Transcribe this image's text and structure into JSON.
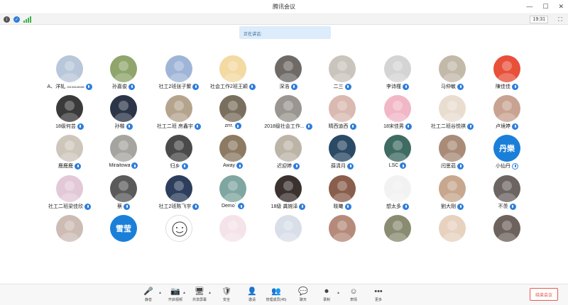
{
  "window": {
    "title": "腾讯会议",
    "controls": [
      "—",
      "☐",
      "✕"
    ]
  },
  "infobar": {
    "time": "19:31"
  },
  "speaking": {
    "label": "正在讲话:"
  },
  "participants": [
    {
      "name": "A、洋轧",
      "suffix": "15134448188",
      "avatar_color": "#b8c7d9",
      "avatar_text": "",
      "mic": "on"
    },
    {
      "name": "孙嘉俊",
      "avatar_color": "#8fa56b",
      "avatar_text": "",
      "mic": "on"
    },
    {
      "name": "社工2班张子蘩",
      "avatar_color": "#9fb5d8",
      "avatar_text": "",
      "mic": "on"
    },
    {
      "name": "社会工作2班王颖",
      "avatar_color": "#f3d9a2",
      "avatar_text": "",
      "mic": "on"
    },
    {
      "name": "深浩",
      "avatar_color": "#6f6a66",
      "avatar_text": "",
      "mic": "on"
    },
    {
      "name": "二三",
      "avatar_color": "#c9c4bc",
      "avatar_text": "",
      "mic": "on"
    },
    {
      "name": "李诗槿",
      "avatar_color": "#d4d4d4",
      "avatar_text": "",
      "mic": "on"
    },
    {
      "name": "马仲敏",
      "avatar_color": "#c2b9a8",
      "avatar_text": "",
      "mic": "on"
    },
    {
      "name": "陳佳佳",
      "avatar_color": "#e8503a",
      "avatar_text": "",
      "mic": "on"
    },
    {
      "name": "18级何芸",
      "avatar_color": "#3a3a3a",
      "avatar_text": "",
      "mic": "on"
    },
    {
      "name": "孙楷",
      "avatar_color": "#2c3548",
      "avatar_text": "",
      "mic": "on"
    },
    {
      "name": "社工二班 房鑫宇",
      "avatar_color": "#b5a48d",
      "avatar_text": "",
      "mic": "on"
    },
    {
      "name": "zrrr.",
      "avatar_color": "#7a6f5e",
      "avatar_text": "",
      "mic": "on"
    },
    {
      "name": "2018级社会工作...",
      "avatar_color": "#9a9590",
      "avatar_text": "",
      "mic": "on"
    },
    {
      "name": "晴西迪西",
      "avatar_color": "#d9b9b0",
      "avatar_text": "",
      "mic": "on"
    },
    {
      "name": "18宋佳男",
      "avatar_color": "#f1b7c7",
      "avatar_text": "",
      "mic": "on"
    },
    {
      "name": "社工二班谷悦祺",
      "avatar_color": "#e9ddd0",
      "avatar_text": "",
      "mic": "on"
    },
    {
      "name": "卢境婷",
      "avatar_color": "#c8a391",
      "avatar_text": "",
      "mic": "on"
    },
    {
      "name": "鹿鹿鹿",
      "avatar_color": "#cfc6bb",
      "avatar_text": "",
      "mic": "on"
    },
    {
      "name": "Miraitowa",
      "avatar_color": "#a6a49e",
      "avatar_text": "",
      "mic": "on"
    },
    {
      "name": "归乡",
      "avatar_color": "#4a4a4a",
      "avatar_text": "",
      "mic": "on"
    },
    {
      "name": "Away",
      "avatar_color": "#8c7a63",
      "avatar_text": "",
      "mic": "on"
    },
    {
      "name": "迟迎婷",
      "avatar_color": "#bdb4a8",
      "avatar_text": "",
      "mic": "on"
    },
    {
      "name": "薛清月",
      "avatar_color": "#2b4a66",
      "avatar_text": "",
      "mic": "on"
    },
    {
      "name": "LSC",
      "avatar_color": "#3f6b63",
      "avatar_text": "",
      "mic": "on"
    },
    {
      "name": "闫思茹",
      "avatar_color": "#a98b78",
      "avatar_text": "",
      "mic": "on"
    },
    {
      "name": "小仙丹",
      "avatar_color": "#1a7fd9",
      "avatar_text": "丹樂",
      "mic": "muted"
    },
    {
      "name": "社工二班梁佳欣",
      "avatar_color": "#e3c8d8",
      "avatar_text": "",
      "mic": "on"
    },
    {
      "name": "蔡",
      "avatar_color": "#5a5a5a",
      "avatar_text": "",
      "mic": "on"
    },
    {
      "name": "社工2班陈飞宇",
      "avatar_color": "#2c3e5c",
      "avatar_text": "",
      "mic": "on"
    },
    {
      "name": "Demo`",
      "avatar_color": "#7fa6a0",
      "avatar_text": "",
      "mic": "on"
    },
    {
      "name": "18级 龚婉泽",
      "avatar_color": "#3b3230",
      "avatar_text": "",
      "mic": "on"
    },
    {
      "name": "晓曦",
      "avatar_color": "#8a5e4c",
      "avatar_text": "",
      "mic": "on"
    },
    {
      "name": "想太多",
      "avatar_color": "#f2f2f2",
      "avatar_text": "",
      "mic": "on"
    },
    {
      "name": "劉大剛",
      "avatar_color": "#c7a78e",
      "avatar_text": "",
      "mic": "on"
    },
    {
      "name": "不羡",
      "avatar_color": "#6b6461",
      "avatar_text": "",
      "mic": "on"
    },
    {
      "name": "",
      "avatar_color": "#cdbcb4",
      "avatar_text": "",
      "mic": "none"
    },
    {
      "name": "",
      "avatar_color": "#1a7fd9",
      "avatar_text": "雪莹",
      "mic": "none"
    },
    {
      "name": "",
      "avatar_color": "#ffffff",
      "avatar_text": "",
      "mic": "none",
      "smiley": true
    },
    {
      "name": "",
      "avatar_color": "#f4e4ea",
      "avatar_text": "",
      "mic": "none"
    },
    {
      "name": "",
      "avatar_color": "#d9dfe9",
      "avatar_text": "",
      "mic": "none"
    },
    {
      "name": "",
      "avatar_color": "#b58a7a",
      "avatar_text": "",
      "mic": "none"
    },
    {
      "name": "",
      "avatar_color": "#8a8c72",
      "avatar_text": "",
      "mic": "none"
    },
    {
      "name": "",
      "avatar_color": "#e7d2bf",
      "avatar_text": "",
      "mic": "none"
    },
    {
      "name": "",
      "avatar_color": "#6e625c",
      "avatar_text": "",
      "mic": "none"
    }
  ],
  "toolbar": {
    "items": [
      {
        "icon": "🎤",
        "label": "静音",
        "icon_name": "microphone-icon"
      },
      {
        "icon": "📷",
        "label": "开启视频",
        "icon_name": "camera-off-icon"
      },
      {
        "icon": "🖥",
        "label": "共享屏幕",
        "icon_name": "share-screen-icon"
      },
      {
        "icon": "🛡",
        "label": "安全",
        "icon_name": "shield-icon"
      },
      {
        "icon": "👤",
        "label": "邀请",
        "icon_name": "invite-icon"
      },
      {
        "icon": "👥",
        "label": "管理成员(45)",
        "icon_name": "members-icon"
      },
      {
        "icon": "💬",
        "label": "聊天",
        "icon_name": "chat-icon"
      },
      {
        "icon": "⏺",
        "label": "录制",
        "icon_name": "record-icon"
      },
      {
        "icon": "☺",
        "label": "表情",
        "icon_name": "emoji-icon"
      },
      {
        "icon": "•••",
        "label": "更多",
        "icon_name": "more-icon"
      }
    ],
    "end_label": "结束会议"
  },
  "colors": {
    "accent": "#2f7ed8",
    "end": "#e04b3f"
  }
}
